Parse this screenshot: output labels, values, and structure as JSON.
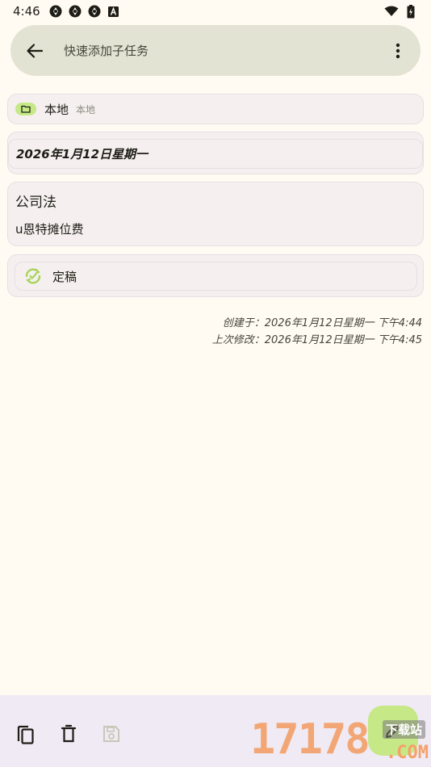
{
  "status_bar": {
    "time": "4:46",
    "left_icons": [
      "app-notification-icon",
      "app-notification-icon",
      "app-notification-icon",
      "font-a-icon"
    ],
    "right_icons": [
      "wifi-icon",
      "battery-icon"
    ]
  },
  "top_bar": {
    "title": "快速添加子任务",
    "back_icon": "arrow-back-icon",
    "more_icon": "more-vert-icon"
  },
  "local_card": {
    "icon": "folder-icon",
    "name": "本地",
    "subtitle": "本地"
  },
  "date_card": {
    "date": "2026年1月12日星期一"
  },
  "note_card": {
    "title": "公司法",
    "body": "u恩特摊位费"
  },
  "status_card": {
    "icon": "sync-check-icon",
    "label": "定稿"
  },
  "meta": {
    "created": "创建于：2026年1月12日星期一 下午4:44",
    "modified": "上次修改：2026年1月12日星期一 下午4:45"
  },
  "bottom_bar": {
    "actions": [
      "copy-icon",
      "delete-icon",
      "save-icon"
    ],
    "fab_icon": "edit-icon"
  },
  "watermark": {
    "number": "17178",
    "download_text": "下载站",
    "domain": ".COM"
  },
  "colors": {
    "background": "#fffbf2",
    "top_bar": "#e3e3d3",
    "card": "#f5f0ef",
    "accent_green": "#c6e887",
    "bottom_bar": "#efeaf3"
  }
}
